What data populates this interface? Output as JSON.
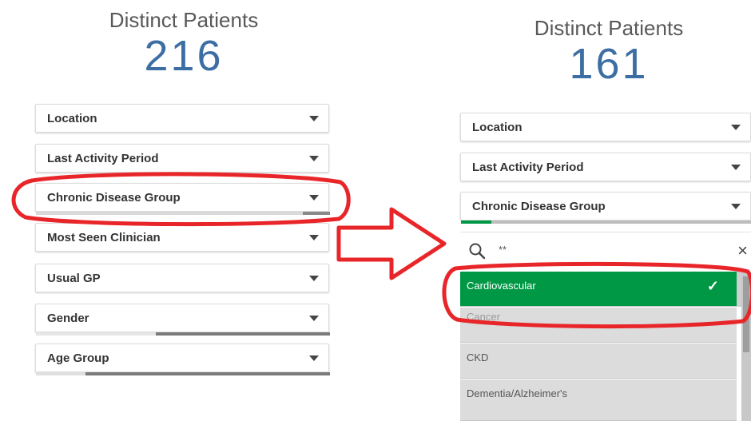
{
  "left_panel": {
    "kpi_title": "Distinct Patients",
    "kpi_value": "216",
    "filters": [
      {
        "label": "Location"
      },
      {
        "label": "Last Activity Period"
      },
      {
        "label": "Chronic Disease Group"
      },
      {
        "label": "Most Seen Clinician"
      },
      {
        "label": "Usual GP"
      },
      {
        "label": "Gender"
      },
      {
        "label": "Age Group"
      }
    ]
  },
  "right_panel": {
    "kpi_title": "Distinct Patients",
    "kpi_value": "161",
    "filters": [
      {
        "label": "Location"
      },
      {
        "label": "Last Activity Period"
      },
      {
        "label": "Chronic Disease Group"
      }
    ],
    "search": {
      "value": "**",
      "clear_glyph": "×"
    },
    "list_items": [
      {
        "label": "Cardiovascular",
        "selected": true,
        "check": "✓"
      },
      {
        "label": "Cancer",
        "selected": false
      },
      {
        "label": "CKD",
        "selected": false
      },
      {
        "label": "Dementia/Alzheimer's",
        "selected": false
      }
    ]
  },
  "annotations": {
    "highlight_color": "#e8262a",
    "arrow_direction": "right"
  },
  "colors": {
    "kpi_value": "#3c6ea4",
    "selected_green": "#009845",
    "alternative_gray": "#dcdcdc",
    "state_bar_dark": "#7a7a7a"
  }
}
